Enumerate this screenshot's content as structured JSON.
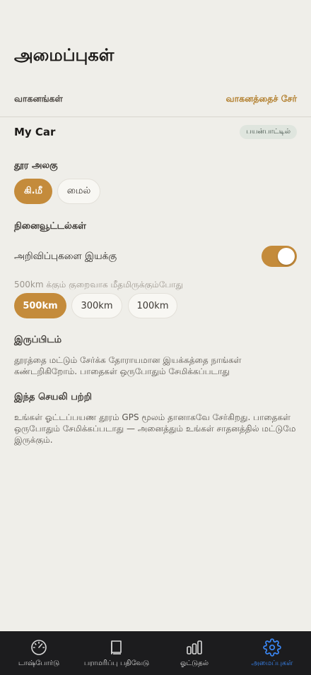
{
  "page": {
    "title": "அமைப்புகள்"
  },
  "vehicles": {
    "label": "வாகனங்கள்",
    "add_label": "வாகனத்தைச் சேர்",
    "items": [
      {
        "name": "My Car",
        "badge": "பயன்பாட்டில்"
      }
    ]
  },
  "distance_unit": {
    "label": "தூர அலகு",
    "options": [
      {
        "label": "கி.மீ",
        "selected": true
      },
      {
        "label": "மைல்",
        "selected": false
      }
    ]
  },
  "reminders": {
    "label": "நினைவூட்டல்கள்",
    "toggle_label": "அறிவிப்புகளை இயக்கு",
    "toggle_on": true,
    "hint": "500km க்கும் குறைவாக மீதமிருக்கும்போது",
    "options": [
      {
        "label": "500km",
        "selected": true
      },
      {
        "label": "300km",
        "selected": false
      },
      {
        "label": "100km",
        "selected": false
      }
    ]
  },
  "location": {
    "label": "இருப்பிடம்",
    "text_lines": [
      "தூரத்தை மட்டும் சேர்க்க தோராயமான இயக்கத்தை நாங்கள்",
      "கண்டறிகிறோம். பாதைகள் ஒருபோதும் சேமிக்கப்படாது"
    ]
  },
  "about": {
    "label": "இந்த செயலி பற்றி",
    "text_lines": [
      "உங்கள் ஓட்டப்பயண தூரம் GPS மூலம் தானாகவே சேர்கிறது. பாதைகள்",
      "ஒருபோதும் சேமிக்கப்படாது — அனைத்தும் உங்கள் சாதனத்தில் மட்டுமே",
      "இருக்கும்."
    ]
  },
  "tabbar": {
    "items": [
      {
        "label": "டாஷ்போர்டு",
        "icon": "speedometer-icon",
        "active": false
      },
      {
        "label": "பராமரிப்பு பதிவேடு",
        "icon": "book-icon",
        "active": false
      },
      {
        "label": "ஓட்டுதல்",
        "icon": "bar-chart-icon",
        "active": false
      },
      {
        "label": "அமைப்புகள்",
        "icon": "gear-icon",
        "active": true
      }
    ]
  },
  "colors": {
    "accent": "#c48b3b",
    "background": "#efeee9",
    "tab_active": "#3a87f5",
    "tabbar_bg": "#1c1c1e"
  }
}
